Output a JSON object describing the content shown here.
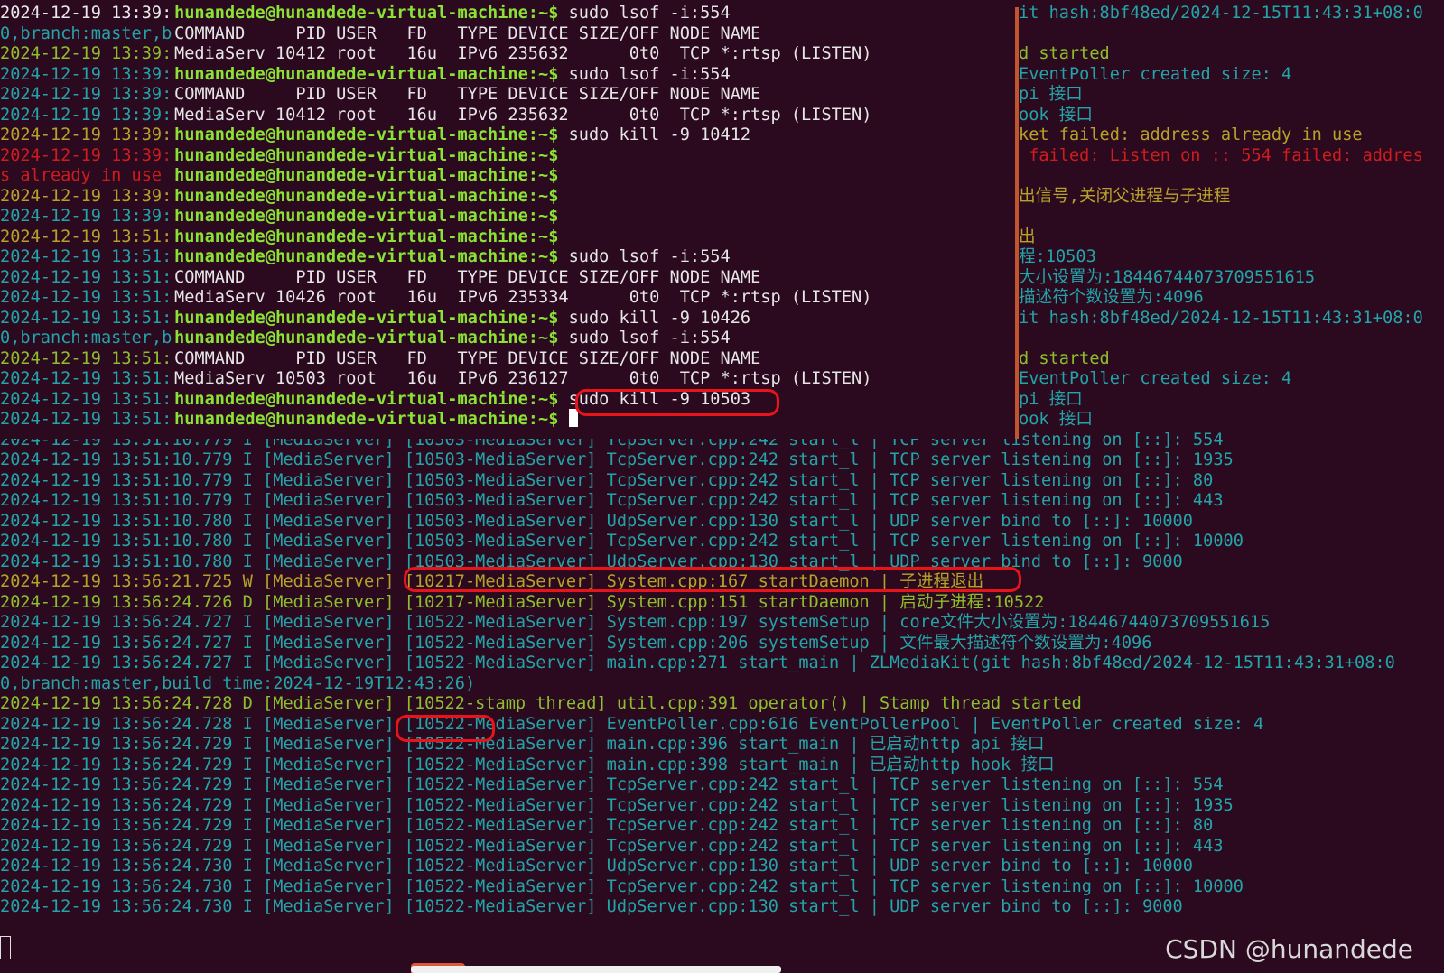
{
  "terminal": {
    "lines": [
      {
        "ts": "2024-12-19 13:39:",
        "ts_color": "c-white",
        "prompt": "hunandede@hunandede-virtual-machine:~$",
        "text": " sudo lsof -i:554"
      },
      {
        "ts": "0,branch:master,b",
        "ts_color": "c-cyan",
        "prompt": "",
        "text": "COMMAND     PID USER   FD   TYPE DEVICE SIZE/OFF NODE NAME"
      },
      {
        "ts": "2024-12-19 13:39:",
        "ts_color": "c-green",
        "prompt": "",
        "text": "MediaServ 10412 root   16u  IPv6 235632      0t0  TCP *:rtsp (LISTEN)"
      },
      {
        "ts": "2024-12-19 13:39:",
        "ts_color": "c-cyan",
        "prompt": "hunandede@hunandede-virtual-machine:~$",
        "text": " sudo lsof -i:554"
      },
      {
        "ts": "2024-12-19 13:39:",
        "ts_color": "c-cyan",
        "prompt": "",
        "text": "COMMAND     PID USER   FD   TYPE DEVICE SIZE/OFF NODE NAME"
      },
      {
        "ts": "2024-12-19 13:39:",
        "ts_color": "c-cyan",
        "prompt": "",
        "text": "MediaServ 10412 root   16u  IPv6 235632      0t0  TCP *:rtsp (LISTEN)"
      },
      {
        "ts": "2024-12-19 13:39:",
        "ts_color": "c-yellow",
        "prompt": "hunandede@hunandede-virtual-machine:~$",
        "text": " sudo kill -9 10412"
      },
      {
        "ts": "2024-12-19 13:39:",
        "ts_color": "c-red",
        "prompt": "hunandede@hunandede-virtual-machine:~$",
        "text": ""
      },
      {
        "ts": "s already in use ",
        "ts_color": "c-red",
        "prompt": "hunandede@hunandede-virtual-machine:~$",
        "text": ""
      },
      {
        "ts": "2024-12-19 13:39:",
        "ts_color": "c-yellow",
        "prompt": "hunandede@hunandede-virtual-machine:~$",
        "text": ""
      },
      {
        "ts": "2024-12-19 13:39:",
        "ts_color": "c-cyan",
        "prompt": "hunandede@hunandede-virtual-machine:~$",
        "text": ""
      },
      {
        "ts": "2024-12-19 13:51:",
        "ts_color": "c-yellow",
        "prompt": "hunandede@hunandede-virtual-machine:~$",
        "text": ""
      },
      {
        "ts": "2024-12-19 13:51:",
        "ts_color": "c-cyan",
        "prompt": "hunandede@hunandede-virtual-machine:~$",
        "text": " sudo lsof -i:554"
      },
      {
        "ts": "2024-12-19 13:51:",
        "ts_color": "c-cyan",
        "prompt": "",
        "text": "COMMAND     PID USER   FD   TYPE DEVICE SIZE/OFF NODE NAME"
      },
      {
        "ts": "2024-12-19 13:51:",
        "ts_color": "c-cyan",
        "prompt": "",
        "text": "MediaServ 10426 root   16u  IPv6 235334      0t0  TCP *:rtsp (LISTEN)"
      },
      {
        "ts": "2024-12-19 13:51:",
        "ts_color": "c-cyan",
        "prompt": "hunandede@hunandede-virtual-machine:~$",
        "text": " sudo kill -9 10426"
      },
      {
        "ts": "0,branch:master,b",
        "ts_color": "c-cyan",
        "prompt": "hunandede@hunandede-virtual-machine:~$",
        "text": " sudo lsof -i:554"
      },
      {
        "ts": "2024-12-19 13:51:",
        "ts_color": "c-green",
        "prompt": "",
        "text": "COMMAND     PID USER   FD   TYPE DEVICE SIZE/OFF NODE NAME"
      },
      {
        "ts": "2024-12-19 13:51:",
        "ts_color": "c-cyan",
        "prompt": "",
        "text": "MediaServ 10503 root   16u  IPv6 236127      0t0  TCP *:rtsp (LISTEN)"
      },
      {
        "ts": "2024-12-19 13:51:",
        "ts_color": "c-cyan",
        "prompt": "hunandede@hunandede-virtual-machine:~$",
        "text": " sudo kill -9 10503"
      },
      {
        "ts": "2024-12-19 13:51:",
        "ts_color": "c-cyan",
        "prompt": "hunandede@hunandede-virtual-machine:~$",
        "text": " ",
        "cursor": true
      }
    ],
    "right_fragments": [
      {
        "text": "it hash:8bf48ed/2024-12-15T11:43:31+08:0",
        "color": "c-cyan"
      },
      {
        "text": "",
        "color": "c-cyan"
      },
      {
        "text": "d started",
        "color": "c-green"
      },
      {
        "text": "EventPoller created size: 4",
        "color": "c-cyan"
      },
      {
        "text": "pi 接口",
        "color": "c-cyan"
      },
      {
        "text": "ook 接口",
        "color": "c-cyan"
      },
      {
        "text": "ket failed: address already in use",
        "color": "c-yellow"
      },
      {
        "text": " failed: Listen on :: 554 failed: addres",
        "color": "c-red"
      },
      {
        "text": "",
        "color": "c-red"
      },
      {
        "text": "出信号,关闭父进程与子进程",
        "color": "c-yellow"
      },
      {
        "text": "",
        "color": "c-cyan"
      },
      {
        "text": "出",
        "color": "c-yellow"
      },
      {
        "text": "程:10503",
        "color": "c-cyan"
      },
      {
        "text": "大小设置为:18446744073709551615",
        "color": "c-cyan"
      },
      {
        "text": "描述符个数设置为:4096",
        "color": "c-cyan"
      },
      {
        "text": "it hash:8bf48ed/2024-12-15T11:43:31+08:0",
        "color": "c-cyan"
      },
      {
        "text": "",
        "color": "c-cyan"
      },
      {
        "text": "d started",
        "color": "c-green"
      },
      {
        "text": "EventPoller created size: 4",
        "color": "c-cyan"
      },
      {
        "text": "pi 接口",
        "color": "c-cyan"
      },
      {
        "text": "ook 接口",
        "color": "c-cyan"
      }
    ],
    "log_lines": [
      {
        "text": "2024-12-19 13:51:10.779 I [MediaServer] [10503-MediaServer] TcpServer.cpp:242 start_l | TCP server listening on [::]: 554",
        "color": "c-cyan"
      },
      {
        "text": "2024-12-19 13:51:10.779 I [MediaServer] [10503-MediaServer] TcpServer.cpp:242 start_l | TCP server listening on [::]: 1935",
        "color": "c-cyan"
      },
      {
        "text": "2024-12-19 13:51:10.779 I [MediaServer] [10503-MediaServer] TcpServer.cpp:242 start_l | TCP server listening on [::]: 80",
        "color": "c-cyan"
      },
      {
        "text": "2024-12-19 13:51:10.779 I [MediaServer] [10503-MediaServer] TcpServer.cpp:242 start_l | TCP server listening on [::]: 443",
        "color": "c-cyan"
      },
      {
        "text": "2024-12-19 13:51:10.780 I [MediaServer] [10503-MediaServer] UdpServer.cpp:130 start_l | UDP server bind to [::]: 10000",
        "color": "c-cyan"
      },
      {
        "text": "2024-12-19 13:51:10.780 I [MediaServer] [10503-MediaServer] TcpServer.cpp:242 start_l | TCP server listening on [::]: 10000",
        "color": "c-cyan"
      },
      {
        "text": "2024-12-19 13:51:10.780 I [MediaServer] [10503-MediaServer] UdpServer.cpp:130 start_l | UDP server bind to [::]: 9000",
        "color": "c-cyan"
      },
      {
        "text": "2024-12-19 13:56:21.725 W [MediaServer] [10217-MediaServer] System.cpp:167 startDaemon | 子进程退出",
        "color": "c-yellow"
      },
      {
        "text": "2024-12-19 13:56:24.726 D [MediaServer] [10217-MediaServer] System.cpp:151 startDaemon | 启动子进程:10522",
        "color": "c-green"
      },
      {
        "text": "2024-12-19 13:56:24.727 I [MediaServer] [10522-MediaServer] System.cpp:197 systemSetup | core文件大小设置为:18446744073709551615",
        "color": "c-cyan"
      },
      {
        "text": "2024-12-19 13:56:24.727 I [MediaServer] [10522-MediaServer] System.cpp:206 systemSetup | 文件最大描述符个数设置为:4096",
        "color": "c-cyan"
      },
      {
        "text": "2024-12-19 13:56:24.727 I [MediaServer] [10522-MediaServer] main.cpp:271 start_main | ZLMediaKit(git hash:8bf48ed/2024-12-15T11:43:31+08:0",
        "color": "c-cyan"
      },
      {
        "text": "0,branch:master,build time:2024-12-19T12:43:26)",
        "color": "c-cyan"
      },
      {
        "text": "2024-12-19 13:56:24.728 D [MediaServer] [10522-stamp thread] util.cpp:391 operator() | Stamp thread started",
        "color": "c-green"
      },
      {
        "text": "2024-12-19 13:56:24.728 I [MediaServer] [10522-MediaServer] EventPoller.cpp:616 EventPollerPool | EventPoller created size: 4",
        "color": "c-cyan"
      },
      {
        "text": "2024-12-19 13:56:24.729 I [MediaServer] [10522-MediaServer] main.cpp:396 start_main | 已启动http api 接口",
        "color": "c-cyan"
      },
      {
        "text": "2024-12-19 13:56:24.729 I [MediaServer] [10522-MediaServer] main.cpp:398 start_main | 已启动http hook 接口",
        "color": "c-cyan"
      },
      {
        "text": "2024-12-19 13:56:24.729 I [MediaServer] [10522-MediaServer] TcpServer.cpp:242 start_l | TCP server listening on [::]: 554",
        "color": "c-cyan"
      },
      {
        "text": "2024-12-19 13:56:24.729 I [MediaServer] [10522-MediaServer] TcpServer.cpp:242 start_l | TCP server listening on [::]: 1935",
        "color": "c-cyan"
      },
      {
        "text": "2024-12-19 13:56:24.729 I [MediaServer] [10522-MediaServer] TcpServer.cpp:242 start_l | TCP server listening on [::]: 80",
        "color": "c-cyan"
      },
      {
        "text": "2024-12-19 13:56:24.729 I [MediaServer] [10522-MediaServer] TcpServer.cpp:242 start_l | TCP server listening on [::]: 443",
        "color": "c-cyan"
      },
      {
        "text": "2024-12-19 13:56:24.730 I [MediaServer] [10522-MediaServer] UdpServer.cpp:130 start_l | UDP server bind to [::]: 10000",
        "color": "c-cyan"
      },
      {
        "text": "2024-12-19 13:56:24.730 I [MediaServer] [10522-MediaServer] TcpServer.cpp:242 start_l | TCP server listening on [::]: 10000",
        "color": "c-cyan"
      },
      {
        "text": "2024-12-19 13:56:24.730 I [MediaServer] [10522-MediaServer] UdpServer.cpp:130 start_l | UDP server bind to [::]: 9000",
        "color": "c-cyan"
      }
    ]
  },
  "watermark": "CSDN @hunandede",
  "colors": {
    "background": "#2b0a1f",
    "prompt": "#8ae234",
    "log_info": "#22a4a8",
    "log_warn": "#b7a229",
    "log_debug": "#8cbf2b",
    "log_error": "#d01c1c",
    "annotation": "#e8141a"
  }
}
